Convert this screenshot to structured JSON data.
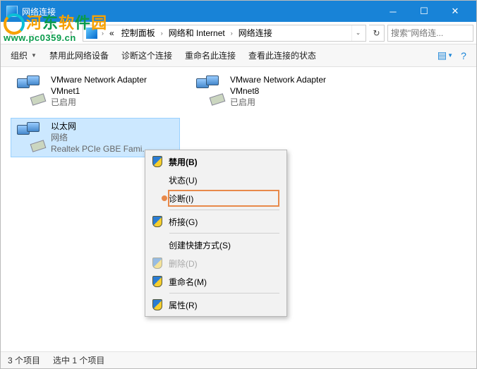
{
  "window": {
    "title": "网络连接"
  },
  "breadcrumb": {
    "root_marker": "«",
    "panel": "控制面板",
    "net": "网络和 Internet",
    "conn": "网络连接"
  },
  "search": {
    "placeholder": "搜索\"网络连..."
  },
  "toolbar": {
    "organize": "组织",
    "disable": "禁用此网络设备",
    "diagnose": "诊断这个连接",
    "rename": "重命名此连接",
    "status": "查看此连接的状态"
  },
  "adapters": [
    {
      "name": "VMware Network Adapter VMnet1",
      "state": "已启用",
      "desc": ""
    },
    {
      "name": "VMware Network Adapter VMnet8",
      "state": "已启用",
      "desc": ""
    },
    {
      "name": "以太网",
      "state": "网络",
      "desc": "Realtek PCIe GBE Fami..."
    }
  ],
  "menu": {
    "disable": "禁用(B)",
    "status": "状态(U)",
    "diagnose": "诊断(I)",
    "bridge": "桥接(G)",
    "shortcut": "创建快捷方式(S)",
    "delete": "删除(D)",
    "rename": "重命名(M)",
    "properties": "属性(R)"
  },
  "statusbar": {
    "count": "3 个项目",
    "selected": "选中 1 个项目"
  }
}
